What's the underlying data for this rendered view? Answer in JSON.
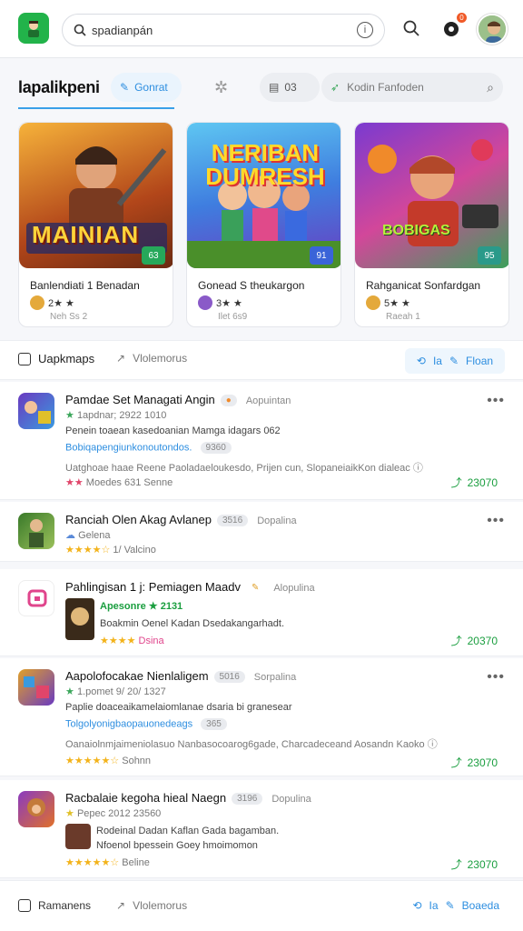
{
  "search": {
    "value": "spadianpán"
  },
  "notifications": {
    "count": "0"
  },
  "tabs": {
    "title": "lapalikpeni",
    "pill_blue": "Gonrat",
    "pill_gray": "03",
    "pill_wide": "Kodin Fanfoden"
  },
  "featured": [
    {
      "title": "Banlendiati 1 Benadan",
      "art_text": "MAINIAN",
      "corner": "63",
      "rating": "2★ ★",
      "sub": "Neh Ss 2"
    },
    {
      "title": "Gonead S theukargon",
      "art_text": "NERIBAN DUMRESH",
      "corner": "91",
      "rating": "3★ ★",
      "sub": "Ilet 6s9"
    },
    {
      "title": "Rahganicat Sonfardgan",
      "art_text": "BOBIGAS",
      "corner": "95",
      "rating": "5★ ★",
      "sub": "Raeah 1"
    }
  ],
  "section_top": {
    "left": "Uapkmaps",
    "mid": "Vlolemorus",
    "right_a": "Ia",
    "right_b": "Floan"
  },
  "items": [
    {
      "name": "Pamdae Set Managati Angin",
      "tag": "●",
      "cat": "Aopuintan",
      "line1": "1apdnar; 2922 1010",
      "line2": "Penein toaean kasedoanian Mamga idagars 062",
      "line3": "Bobiqapengiunkonoutondos.",
      "line3b": "9360",
      "line4": "Uatghoae haae Reene Paoladaeloukesdo, Prijen cun, SlopaneiaikKon dialeac",
      "line5": "Moedes 631 Senne",
      "downloads": "23070"
    },
    {
      "name": "Ranciah Olen Akag Avlanep",
      "tag": "3516",
      "cat": "Dopalina",
      "line1": "Gelena",
      "line2": "1/ Valcino",
      "downloads": ""
    },
    {
      "name": "Pahlingisan 1 j: Pemiagen Maadv",
      "tag": "✎",
      "cat": "Alopulina",
      "line1": "Apesonre ★ 2131",
      "line2": "Boakmin Oenel Kadan Dsedakangarhadt.",
      "line3": "Dsina",
      "downloads": "20370"
    },
    {
      "name": "Aapolofocakae Nienlaligem",
      "tag": "5016",
      "cat": "Sorpalina",
      "line1": "1.pomet 9/ 20/ 1327",
      "line2": "Paplie doaceaikamelaiomlanae dsaria bi granesear",
      "line3": "Tolgolyonigbaopauonedeags",
      "line3b": "365",
      "line4": "Oanaiolnmjaimeniolasuo Nanbasocoarog6gade, Charcadeceand Aosandn Kaoko",
      "line5": "Sohnn",
      "downloads": "23070"
    },
    {
      "name": "Racbalaie kegoha hieal Naegn",
      "tag": "3196",
      "cat": "Dopulina",
      "line1": "Pepec 2012 23560",
      "line2": "Rodeinal Dadan Kaflan Gada bagamban.",
      "line3": "Nfoenol bpessein Goey hmoimomon",
      "line4": "Beline",
      "downloads": "23070"
    }
  ],
  "footer": {
    "left": "Ramanens",
    "mid": "Vlolemorus",
    "right_a": "Ia",
    "right_b": "Boaeda"
  }
}
